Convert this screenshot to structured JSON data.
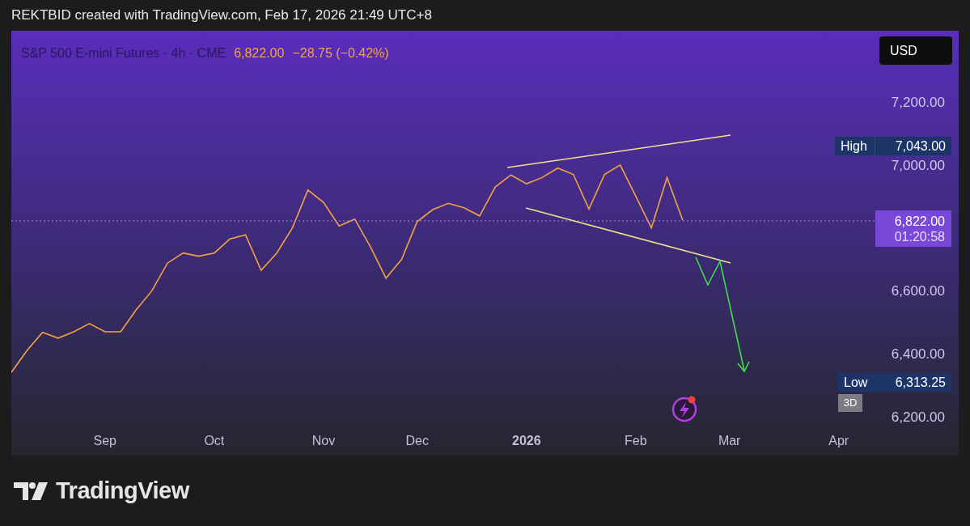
{
  "header": {
    "caption": "REKTBID created with TradingView.com, Feb 17, 2026 21:49 UTC+8"
  },
  "legend": {
    "symbol": "S&P 500 E-mini Futures · 4h · CME",
    "price": "6,822.00",
    "change": "−28.75 (−0.42%)"
  },
  "currency_button": {
    "label": "USD"
  },
  "price_labels": {
    "high_label": "High",
    "high_value": "7,043.00",
    "last_price": "6,822.00",
    "countdown": "01:20:58",
    "low_label": "Low",
    "low_value": "6,313.25",
    "range_badge": "3D"
  },
  "chart_data": {
    "type": "line",
    "ylim": [
      6200,
      7200
    ],
    "categories": [
      null,
      null,
      null,
      null,
      null,
      null,
      "Sep",
      null,
      null,
      null,
      null,
      null,
      null,
      "Oct",
      null,
      null,
      null,
      null,
      null,
      null,
      "Nov",
      null,
      null,
      null,
      null,
      null,
      "Dec",
      null,
      null,
      null,
      null,
      null,
      null,
      "2026",
      null,
      null,
      null,
      null,
      null,
      null,
      "Feb",
      null,
      null,
      null,
      null,
      null,
      "Mar",
      null,
      null,
      null,
      null,
      null,
      null,
      "Apr",
      null,
      null
    ],
    "yticks": [
      {
        "value": 6200,
        "label": "6,200.00"
      },
      {
        "value": 6400,
        "label": "6,400.00"
      },
      {
        "value": 6600,
        "label": "6,600.00"
      },
      {
        "value": 7000,
        "label": "7,000.00"
      },
      {
        "value": 7200,
        "label": "7,200.00"
      }
    ],
    "series": [
      {
        "color": "#f5a342",
        "values": [
          6341,
          6410,
          6468,
          6450,
          6470,
          6496,
          6470,
          6470,
          6540,
          6600,
          6688,
          6720,
          6710,
          6720,
          6765,
          6778,
          6665,
          6720,
          6800,
          6920,
          6881,
          6806,
          6828,
          6740,
          6640,
          6700,
          6820,
          6858,
          6878,
          6864,
          6838,
          6930,
          6968,
          6940,
          6960,
          6990,
          6970,
          6860,
          6970,
          7000,
          6900,
          6800,
          6960,
          6825,
          null,
          null,
          null,
          null,
          null,
          null,
          null,
          null,
          null,
          null,
          null,
          null
        ]
      }
    ]
  },
  "footer": {
    "brand": "TradingView"
  }
}
